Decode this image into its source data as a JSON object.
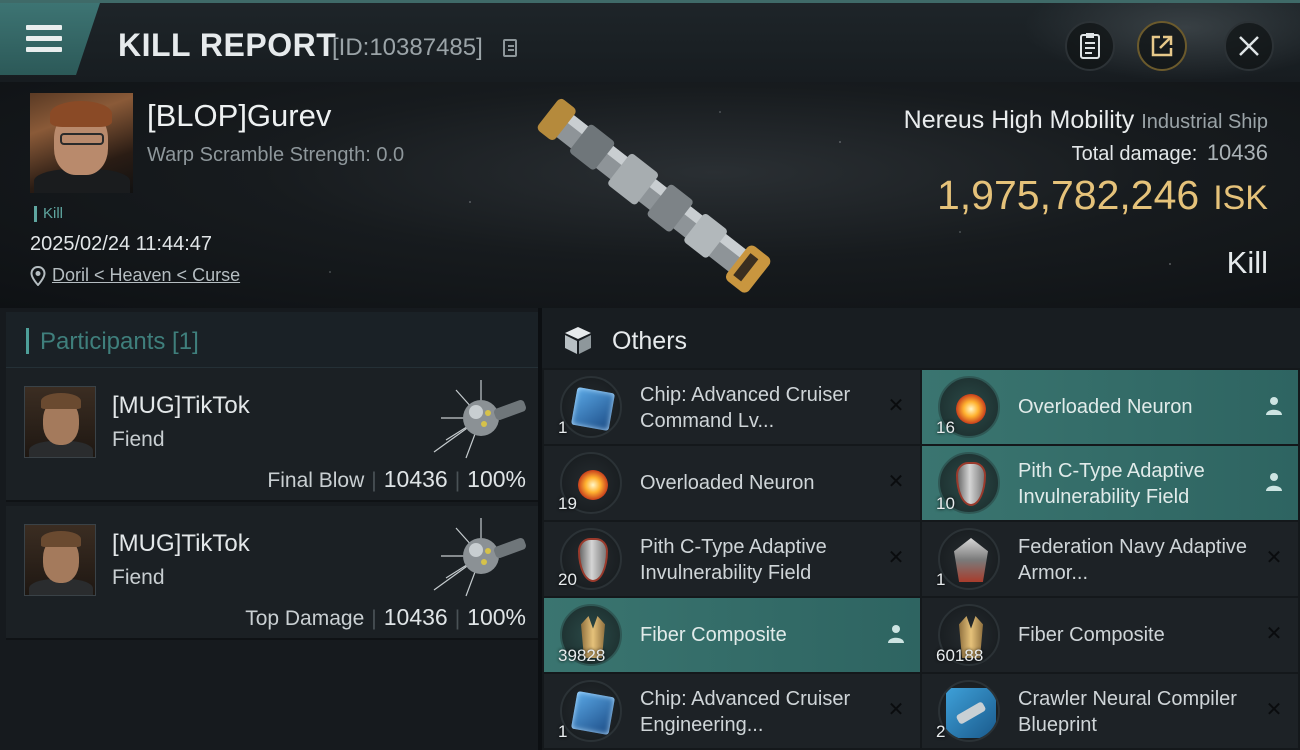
{
  "header": {
    "title": "KILL REPORT",
    "report_id": "[ID:10387485]"
  },
  "victim": {
    "name": "[BLOP]Gurev",
    "warp_scramble": "Warp Scramble Strength: 0.0",
    "tag": "Kill",
    "timestamp": "2025/02/24 11:44:47",
    "location": "Doril < Heaven < Curse"
  },
  "ship": {
    "name": "Nereus High Mobility",
    "class": "Industrial Ship",
    "total_damage_label": "Total damage:",
    "total_damage": "10436",
    "isk_value": "1,975,782,246",
    "isk_unit": "ISK",
    "result": "Kill"
  },
  "participants": {
    "header": "Participants [1]",
    "list": [
      {
        "name": "[MUG]TikTok",
        "ship": "Fiend",
        "role": "Final Blow",
        "damage": "10436",
        "percent": "100%"
      },
      {
        "name": "[MUG]TikTok",
        "ship": "Fiend",
        "role": "Top Damage",
        "damage": "10436",
        "percent": "100%"
      }
    ]
  },
  "others": {
    "title": "Others",
    "items": [
      {
        "name": "Chip: Advanced Cruiser Command Lv...",
        "qty": "1",
        "icon": "chip-icon",
        "dropped": false
      },
      {
        "name": "Overloaded Neuron",
        "qty": "16",
        "icon": "neuron-icon",
        "dropped": true
      },
      {
        "name": "Overloaded Neuron",
        "qty": "19",
        "icon": "neuron-icon",
        "dropped": false
      },
      {
        "name": "Pith C-Type Adaptive Invulnerability Field",
        "qty": "10",
        "icon": "shield-module-icon",
        "dropped": true
      },
      {
        "name": "Pith C-Type Adaptive Invulnerability Field",
        "qty": "20",
        "icon": "shield-module-icon",
        "dropped": false
      },
      {
        "name": "Federation Navy Adaptive Armor...",
        "qty": "1",
        "icon": "armor-module-icon",
        "dropped": false
      },
      {
        "name": "Fiber Composite",
        "qty": "39828",
        "icon": "fiber-composite-icon",
        "dropped": true
      },
      {
        "name": "Fiber Composite",
        "qty": "60188",
        "icon": "fiber-composite-icon",
        "dropped": false
      },
      {
        "name": "Chip: Advanced Cruiser Engineering...",
        "qty": "1",
        "icon": "chip-icon",
        "dropped": false
      },
      {
        "name": "Crawler Neural Compiler Blueprint",
        "qty": "2",
        "icon": "blueprint-icon",
        "dropped": false
      }
    ]
  },
  "colors": {
    "accent_teal": "#3a7570",
    "isk_gold": "#e5c27a",
    "panel_bg": "#1d2226"
  }
}
